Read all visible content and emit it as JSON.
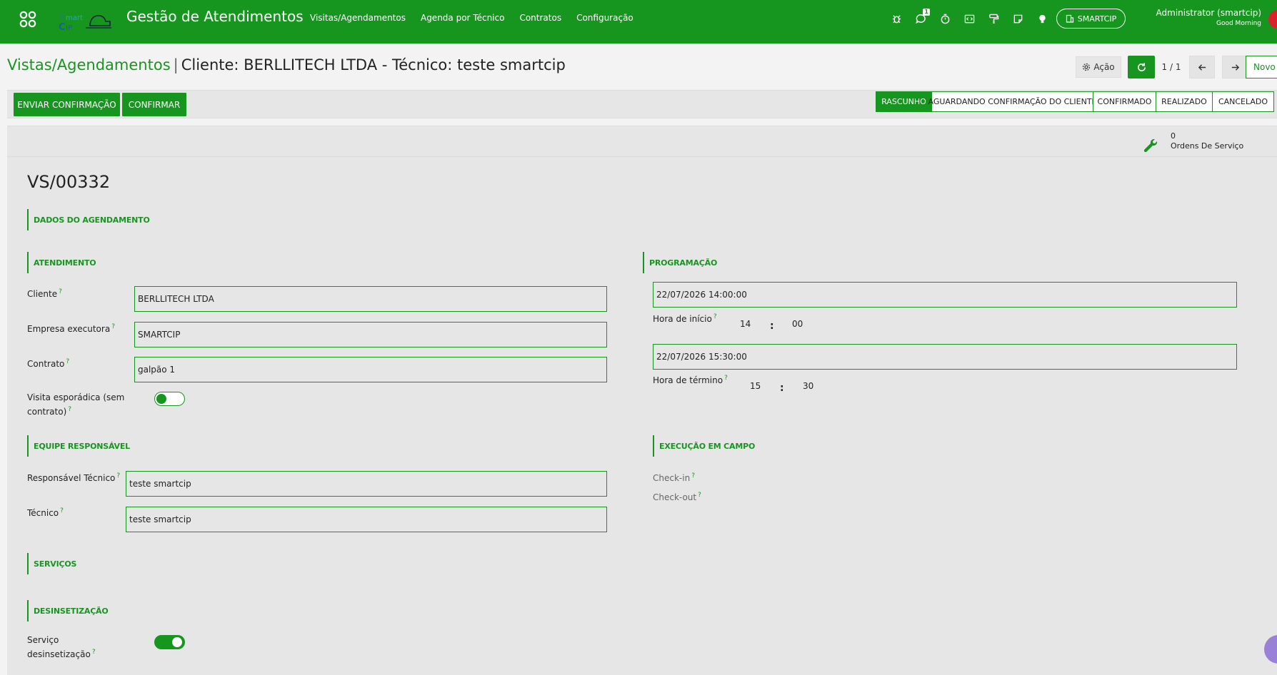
{
  "navbar": {
    "app_title": "Gestão de Atendimentos",
    "menu": [
      "Visitas/Agendamentos",
      "Agenda por Técnico",
      "Contratos",
      "Configuração"
    ],
    "chat_count": "1",
    "company": "SMARTCIP",
    "user_name": "Administrator (smartcip)",
    "user_greeting": "Good Morning",
    "logo_text": "SmartCIP"
  },
  "control_panel": {
    "breadcrumb_parent": "Vistas/Agendamentos",
    "breadcrumb_current": "Cliente: BERLLITECH LTDA - Técnico: teste smartcip",
    "action_label": "Ação",
    "pager": "1 / 1",
    "new_label": "Novo"
  },
  "statusbar": {
    "buttons": [
      "ENVIAR CONFIRMAÇÃO",
      "CONFIRMAR"
    ],
    "stages": [
      "RASCUNHO",
      "AGUARDANDO CONFIRMAÇÃO DO CLIENTE",
      "CONFIRMADO",
      "REALIZADO",
      "CANCELADO"
    ],
    "active_stage": "RASCUNHO"
  },
  "stat_button": {
    "count": "0",
    "label": "Ordens De Serviço"
  },
  "record": {
    "name": "VS/00332",
    "sections": {
      "dados": "DADOS DO AGENDAMENTO",
      "atendimento": "ATENDIMENTO",
      "programacao": "PROGRAMAÇÃO",
      "equipe": "EQUIPE RESPONSÁVEL",
      "execucao": "EXECUÇÃO EM CAMPO",
      "servicos": "SERVIÇOS",
      "desinsetizacao": "DESINSETIZAÇÃO"
    },
    "atendimento": {
      "cliente_label": "Cliente",
      "cliente_value": "BERLLITECH LTDA",
      "empresa_label": "Empresa executora",
      "empresa_value": "SMARTCIP",
      "contrato_label": "Contrato",
      "contrato_value": "galpão 1",
      "esporadica_label_1": "Visita esporádica (sem",
      "esporadica_label_2": "contrato)",
      "esporadica_on": false
    },
    "programacao": {
      "inicio_datetime": "22/07/2026 14:00:00",
      "inicio_label": "Hora de início",
      "inicio_h": "14",
      "inicio_m": "00",
      "termino_datetime": "22/07/2026 15:30:00",
      "termino_label": "Hora de término",
      "termino_h": "15",
      "termino_m": "30",
      "separator": ":"
    },
    "equipe": {
      "responsavel_label": "Responsável Técnico",
      "responsavel_value": "teste smartcip",
      "tecnico_label": "Técnico",
      "tecnico_value": "teste smartcip"
    },
    "execucao": {
      "checkin_label": "Check-in",
      "checkout_label": "Check-out"
    },
    "desinsetizacao": {
      "servico_label_1": "Serviço",
      "servico_label_2": "desinsetização",
      "servico_on": true
    },
    "help_mark": "?"
  },
  "colors": {
    "brand": "#17961f",
    "sheet_bg": "#e6e6e6"
  }
}
